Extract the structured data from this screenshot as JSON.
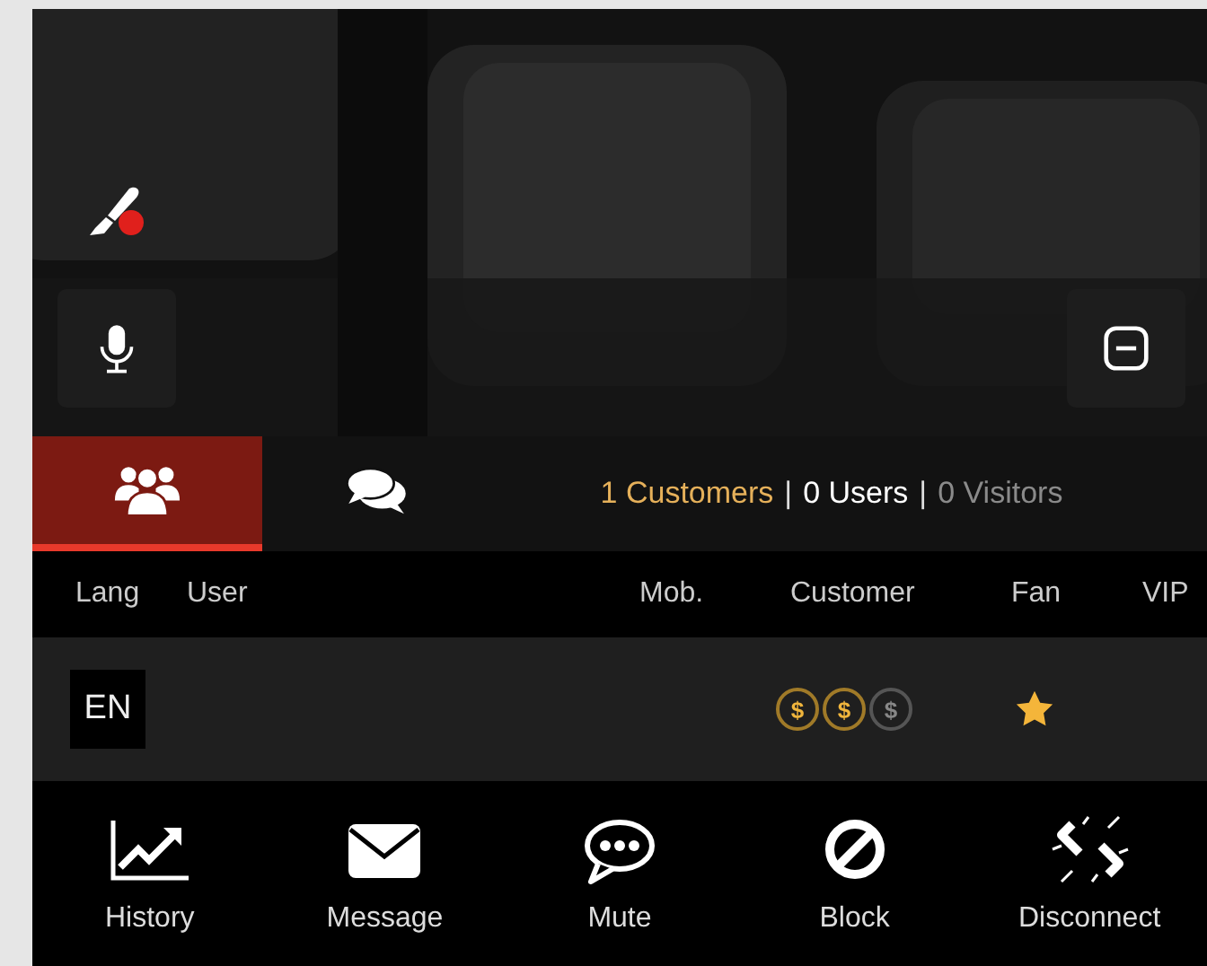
{
  "video": {
    "kind": "picture",
    "recording": true
  },
  "tabs": [
    {
      "kind": "users",
      "selected": true
    },
    {
      "kind": "chat",
      "selected": false
    }
  ],
  "counts": [
    {
      "kind": "customers",
      "text": "1 Customers"
    },
    {
      "kind": "separator",
      "text": "|"
    },
    {
      "kind": "users",
      "text": "0 Users"
    },
    {
      "kind": "separator",
      "text": "|"
    },
    {
      "kind": "visitors",
      "text": "0 Visitors"
    }
  ],
  "columns": [
    "Lang",
    "User",
    "Mob.",
    "Customer",
    "Fan",
    "VIP"
  ],
  "rows": [
    {
      "lang": "EN",
      "coins": [
        {
          "symbol": "$",
          "active": true
        },
        {
          "symbol": "$",
          "active": true
        },
        {
          "symbol": "$",
          "active": false
        }
      ],
      "fan": true
    }
  ],
  "actions": [
    {
      "kind": "history",
      "label": "History"
    },
    {
      "kind": "message",
      "label": "Message"
    },
    {
      "kind": "mute",
      "label": "Mute"
    },
    {
      "kind": "block",
      "label": "Block"
    },
    {
      "kind": "disconnect",
      "label": "Disconnect"
    }
  ]
}
